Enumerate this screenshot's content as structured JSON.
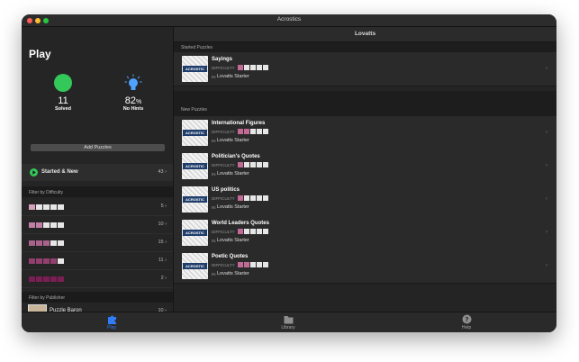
{
  "window": {
    "title": "Acrostics"
  },
  "sidebar": {
    "title": "Play",
    "stats": {
      "solved_value": "11",
      "solved_label": "Solved",
      "hints_value": "82",
      "hints_unit": "%",
      "hints_label": "No Hints"
    },
    "add_button": "Add Puzzles",
    "started_row": {
      "label": "Started & New",
      "count": "43"
    },
    "difficulty_header": "Filter by Difficulty",
    "difficulty_rows": [
      {
        "level": 1,
        "count": "5"
      },
      {
        "level": 2,
        "count": "10"
      },
      {
        "level": 3,
        "count": "15"
      },
      {
        "level": 4,
        "count": "11"
      },
      {
        "level": 5,
        "count": "2"
      }
    ],
    "publisher_header": "Filter by Publisher",
    "publisher_row": {
      "label": "Puzzle Baron",
      "count": "10"
    }
  },
  "main": {
    "header": "Lovatts",
    "started_header": "Started Puzzles",
    "new_header": "New Puzzles",
    "difficulty_label": "DIFFICULTY",
    "in_label": "IN",
    "thumb_text": "ACROSTIC",
    "started": [
      {
        "title": "Sayings",
        "level": 1,
        "publisher": "Lovatts Starter"
      }
    ],
    "new": [
      {
        "title": "International Figures",
        "level": 2,
        "publisher": "Lovatts Starter"
      },
      {
        "title": "Politician's Quotes",
        "level": 1,
        "publisher": "Lovatts Starter"
      },
      {
        "title": "US politics",
        "level": 1,
        "publisher": "Lovatts Starter"
      },
      {
        "title": "World Leaders Quotes",
        "level": 1,
        "publisher": "Lovatts Starter"
      },
      {
        "title": "Poetic Quotes",
        "level": 2,
        "publisher": "Lovatts Starter"
      }
    ]
  },
  "tabs": {
    "play": "Play",
    "library": "Library",
    "help": "Help"
  },
  "colors": {
    "accent": "#2f7cf6",
    "difficulty_on": "#c06a95",
    "difficulty_off": "#e6e6e6",
    "green": "#34c759"
  }
}
